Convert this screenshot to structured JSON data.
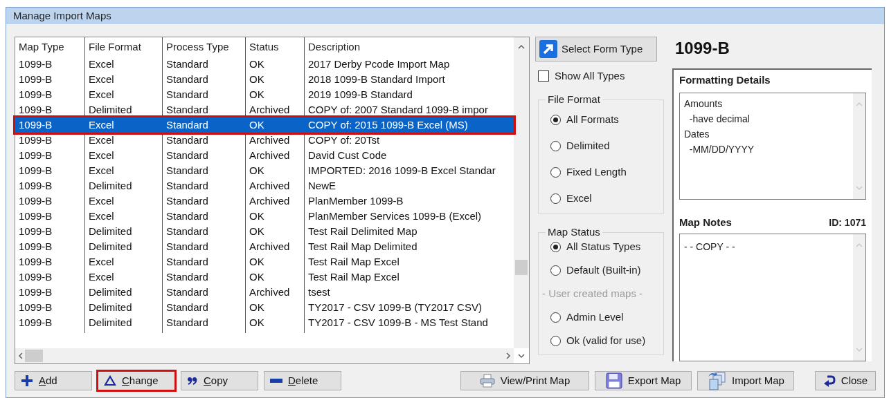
{
  "window": {
    "title": "Manage Import Maps"
  },
  "table": {
    "columns": [
      "Map Type",
      "File Format",
      "Process Type",
      "Status",
      "Description"
    ],
    "rows": [
      {
        "cells": [
          "1099-B",
          "Excel",
          "Standard",
          "OK",
          "2017 Derby Pcode Import Map"
        ],
        "selected": false,
        "annotated": false
      },
      {
        "cells": [
          "1099-B",
          "Excel",
          "Standard",
          "OK",
          "2018 1099-B Standard Import"
        ],
        "selected": false,
        "annotated": false
      },
      {
        "cells": [
          "1099-B",
          "Excel",
          "Standard",
          "OK",
          "2019 1099-B Standard"
        ],
        "selected": false,
        "annotated": false
      },
      {
        "cells": [
          "1099-B",
          "Delimited",
          "Standard",
          "Archived",
          "COPY of: 2007 Standard 1099-B impor"
        ],
        "selected": false,
        "annotated": false
      },
      {
        "cells": [
          "1099-B",
          "Excel",
          "Standard",
          "OK",
          "COPY of: 2015 1099-B Excel (MS)"
        ],
        "selected": true,
        "annotated": true
      },
      {
        "cells": [
          "1099-B",
          "Excel",
          "Standard",
          "Archived",
          "COPY of: 20Tst"
        ],
        "selected": false,
        "annotated": false
      },
      {
        "cells": [
          "1099-B",
          "Excel",
          "Standard",
          "Archived",
          "David Cust Code"
        ],
        "selected": false,
        "annotated": false
      },
      {
        "cells": [
          "1099-B",
          "Excel",
          "Standard",
          "OK",
          "IMPORTED: 2016 1099-B Excel Standar"
        ],
        "selected": false,
        "annotated": false
      },
      {
        "cells": [
          "1099-B",
          "Delimited",
          "Standard",
          "Archived",
          "NewE"
        ],
        "selected": false,
        "annotated": false
      },
      {
        "cells": [
          "1099-B",
          "Excel",
          "Standard",
          "Archived",
          "PlanMember 1099-B"
        ],
        "selected": false,
        "annotated": false
      },
      {
        "cells": [
          "1099-B",
          "Excel",
          "Standard",
          "OK",
          "PlanMember Services 1099-B (Excel)"
        ],
        "selected": false,
        "annotated": false
      },
      {
        "cells": [
          "1099-B",
          "Delimited",
          "Standard",
          "OK",
          "Test Rail Delimited Map"
        ],
        "selected": false,
        "annotated": false
      },
      {
        "cells": [
          "1099-B",
          "Delimited",
          "Standard",
          "Archived",
          "Test Rail Map Delimited"
        ],
        "selected": false,
        "annotated": false
      },
      {
        "cells": [
          "1099-B",
          "Excel",
          "Standard",
          "OK",
          "Test Rail Map Excel"
        ],
        "selected": false,
        "annotated": false
      },
      {
        "cells": [
          "1099-B",
          "Excel",
          "Standard",
          "OK",
          "Test Rail Map Excel"
        ],
        "selected": false,
        "annotated": false
      },
      {
        "cells": [
          "1099-B",
          "Delimited",
          "Standard",
          "Archived",
          "tsest"
        ],
        "selected": false,
        "annotated": false
      },
      {
        "cells": [
          "1099-B",
          "Delimited",
          "Standard",
          "OK",
          "TY2017 - CSV 1099-B (TY2017 CSV)"
        ],
        "selected": false,
        "annotated": false
      },
      {
        "cells": [
          "1099-B",
          "Delimited",
          "Standard",
          "OK",
          "TY2017 - CSV 1099-B - MS Test Stand"
        ],
        "selected": false,
        "annotated": false
      }
    ]
  },
  "select_form_button": "Select Form Type",
  "form_type": "1099-B",
  "show_all_types": {
    "label": "Show All Types",
    "checked": false
  },
  "file_format": {
    "title": "File Format",
    "options": [
      {
        "label": "All Formats",
        "selected": true
      },
      {
        "label": "Delimited",
        "selected": false
      },
      {
        "label": "Fixed Length",
        "selected": false
      },
      {
        "label": "Excel",
        "selected": false
      }
    ]
  },
  "map_status": {
    "title": "Map Status",
    "items": [
      {
        "kind": "radio",
        "label": "All Status Types",
        "selected": true
      },
      {
        "kind": "radio",
        "label": "Default (Built-in)",
        "selected": false
      },
      {
        "kind": "caption",
        "label": "- User created maps -"
      },
      {
        "kind": "radio",
        "label": "Admin Level",
        "selected": false
      },
      {
        "kind": "radio",
        "label": "Ok (valid for use)",
        "selected": false
      }
    ]
  },
  "formatting_details": {
    "title": "Formatting Details",
    "lines": [
      "Amounts",
      "  -have decimal",
      "Dates",
      "  -MM/DD/YYYY"
    ]
  },
  "map_notes": {
    "title": "Map Notes",
    "id": "ID: 1071",
    "text": "- - COPY - -"
  },
  "buttons": [
    {
      "kind": "add",
      "label": "Add",
      "underline_first": true,
      "annotated": false
    },
    {
      "kind": "change",
      "label": "Change",
      "underline_first": true,
      "annotated": true
    },
    {
      "kind": "copy",
      "label": "Copy",
      "underline_first": true,
      "annotated": false
    },
    {
      "kind": "delete",
      "label": "Delete",
      "underline_first": true,
      "annotated": false
    },
    {
      "kind": "print",
      "label": "View/Print Map",
      "underline_first": false,
      "annotated": false
    },
    {
      "kind": "export",
      "label": "Export Map",
      "underline_first": false,
      "annotated": false
    },
    {
      "kind": "import",
      "label": "Import Map",
      "underline_first": false,
      "annotated": false
    },
    {
      "kind": "close",
      "label": "Close",
      "underline_first": false,
      "annotated": false
    }
  ]
}
